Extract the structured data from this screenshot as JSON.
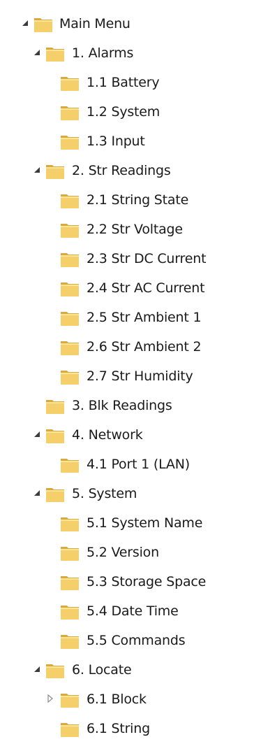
{
  "tree": {
    "root": {
      "label": "Main Menu",
      "expanded": true
    },
    "alarms": {
      "label": "1. Alarms",
      "expanded": true
    },
    "alarms_battery": {
      "label": "1.1 Battery"
    },
    "alarms_system": {
      "label": "1.2 System"
    },
    "alarms_input": {
      "label": "1.3 Input"
    },
    "str_readings": {
      "label": "2. Str Readings",
      "expanded": true
    },
    "str_string_state": {
      "label": "2.1 String State"
    },
    "str_voltage": {
      "label": "2.2 Str Voltage"
    },
    "str_dc_current": {
      "label": "2.3 Str DC Current"
    },
    "str_ac_current": {
      "label": "2.4 Str AC Current"
    },
    "str_ambient_1": {
      "label": "2.5 Str Ambient 1"
    },
    "str_ambient_2": {
      "label": "2.6 Str Ambient 2"
    },
    "str_humidity": {
      "label": "2.7 Str Humidity"
    },
    "blk_readings": {
      "label": "3. Blk Readings"
    },
    "network": {
      "label": "4. Network",
      "expanded": true
    },
    "network_port1": {
      "label": "4.1 Port 1 (LAN)"
    },
    "system": {
      "label": "5. System",
      "expanded": true
    },
    "system_name": {
      "label": "5.1 System Name"
    },
    "system_version": {
      "label": "5.2 Version"
    },
    "system_storage": {
      "label": "5.3 Storage Space"
    },
    "system_datetime": {
      "label": "5.4 Date Time"
    },
    "system_commands": {
      "label": "5.5 Commands"
    },
    "locate": {
      "label": "6. Locate",
      "expanded": true
    },
    "locate_block": {
      "label": "6.1 Block",
      "expanded": false
    },
    "locate_string": {
      "label": "6.1 String"
    }
  },
  "icons": {
    "folder": "folder-icon",
    "expanded": "expanded-arrow-icon",
    "collapsed": "collapsed-arrow-icon"
  },
  "colors": {
    "folder_body": "#f5d06a",
    "folder_shade": "#d9a93a",
    "arrow_expanded": "#3b3b3b",
    "arrow_collapsed": "#8c8c8c"
  }
}
